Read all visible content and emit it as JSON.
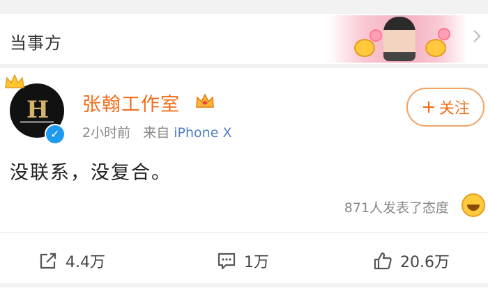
{
  "header": {
    "title": "当事方"
  },
  "post": {
    "username": "张翰工作室",
    "time": "2小时前",
    "source_prefix": "来自",
    "device": "iPhone X",
    "follow_label": "关注",
    "content": "没联系，没复合。",
    "reactions_text": "871人发表了态度"
  },
  "actions": {
    "repost_count": "4.4万",
    "comment_count": "1万",
    "like_count": "20.6万"
  },
  "colors": {
    "username": "#f26d1a",
    "device_link": "#4f7fbf",
    "verify_blue": "#1e9bf0"
  }
}
